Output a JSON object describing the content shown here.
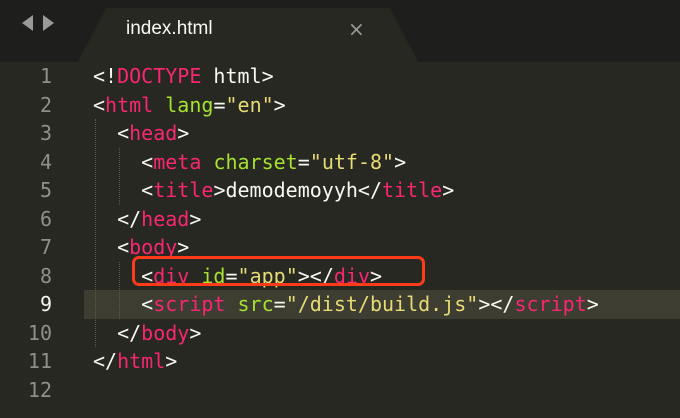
{
  "tab": {
    "title": "index.html",
    "close_glyph": "×",
    "back_glyph": "back-arrow-icon",
    "forward_glyph": "forward-arrow-icon"
  },
  "editor": {
    "current_line": 9,
    "highlighted_line": 8,
    "highlight_color": "#ff3b1a",
    "line_numbers": [
      "1",
      "2",
      "3",
      "4",
      "5",
      "6",
      "7",
      "8",
      "9",
      "10",
      "11",
      "12"
    ],
    "lines": [
      [
        {
          "c": "p",
          "t": "<!"
        },
        {
          "c": "t",
          "t": "DOCTYPE"
        },
        {
          "c": "p",
          "t": " html>"
        }
      ],
      [
        {
          "c": "p",
          "t": "<"
        },
        {
          "c": "t",
          "t": "html"
        },
        {
          "c": "p",
          "t": " "
        },
        {
          "c": "a",
          "t": "lang"
        },
        {
          "c": "p",
          "t": "="
        },
        {
          "c": "s",
          "t": "\"en\""
        },
        {
          "c": "p",
          "t": ">"
        }
      ],
      [
        {
          "c": "p",
          "t": "  <"
        },
        {
          "c": "t",
          "t": "head"
        },
        {
          "c": "p",
          "t": ">"
        }
      ],
      [
        {
          "c": "p",
          "t": "    <"
        },
        {
          "c": "t",
          "t": "meta"
        },
        {
          "c": "p",
          "t": " "
        },
        {
          "c": "a",
          "t": "charset"
        },
        {
          "c": "p",
          "t": "="
        },
        {
          "c": "s",
          "t": "\"utf-8\""
        },
        {
          "c": "p",
          "t": ">"
        }
      ],
      [
        {
          "c": "p",
          "t": "    <"
        },
        {
          "c": "t",
          "t": "title"
        },
        {
          "c": "p",
          "t": ">demodemoyyh</"
        },
        {
          "c": "t",
          "t": "title"
        },
        {
          "c": "p",
          "t": ">"
        }
      ],
      [
        {
          "c": "p",
          "t": "  </"
        },
        {
          "c": "t",
          "t": "head"
        },
        {
          "c": "p",
          "t": ">"
        }
      ],
      [
        {
          "c": "p",
          "t": "  <"
        },
        {
          "c": "t",
          "t": "body"
        },
        {
          "c": "p",
          "t": ">"
        }
      ],
      [
        {
          "c": "p",
          "t": "    <"
        },
        {
          "c": "t",
          "t": "div"
        },
        {
          "c": "p",
          "t": " "
        },
        {
          "c": "a",
          "t": "id"
        },
        {
          "c": "p",
          "t": "="
        },
        {
          "c": "s",
          "t": "\"app\""
        },
        {
          "c": "p",
          "t": "></"
        },
        {
          "c": "t",
          "t": "div"
        },
        {
          "c": "p",
          "t": ">"
        }
      ],
      [
        {
          "c": "p",
          "t": "    <"
        },
        {
          "c": "t",
          "t": "script"
        },
        {
          "c": "p",
          "t": " "
        },
        {
          "c": "a",
          "t": "src"
        },
        {
          "c": "p",
          "t": "="
        },
        {
          "c": "s",
          "t": "\"/dist/build.js\""
        },
        {
          "c": "p",
          "t": "></"
        },
        {
          "c": "t",
          "t": "script"
        },
        {
          "c": "p",
          "t": ">"
        }
      ],
      [
        {
          "c": "p",
          "t": "  </"
        },
        {
          "c": "t",
          "t": "body"
        },
        {
          "c": "p",
          "t": ">"
        }
      ],
      [
        {
          "c": "p",
          "t": "</"
        },
        {
          "c": "t",
          "t": "html"
        },
        {
          "c": "p",
          "t": ">"
        }
      ],
      []
    ]
  },
  "colors": {
    "background": "#272822",
    "tabbar": "#1e1f1c",
    "tag": "#f92672",
    "attribute": "#a6e22e",
    "string": "#e6db74",
    "text": "#f8f8f2",
    "line_number": "#90908a",
    "current_line": "#3e3d32"
  }
}
